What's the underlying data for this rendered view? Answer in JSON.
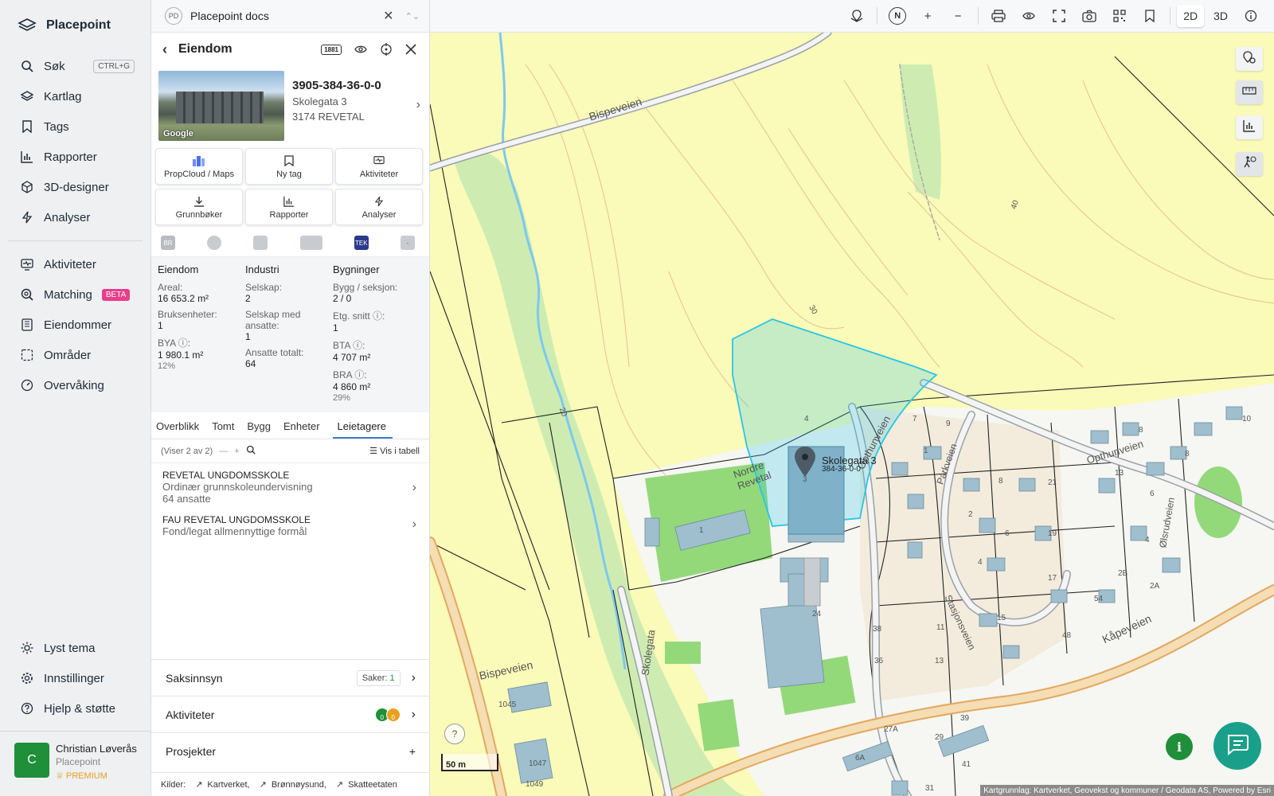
{
  "app": {
    "name": "Placepoint"
  },
  "nav": {
    "items": [
      {
        "label": "Søk",
        "icon": "search-icon",
        "shortcut": "CTRL+G"
      },
      {
        "label": "Kartlag",
        "icon": "layers-icon"
      },
      {
        "label": "Tags",
        "icon": "bookmark-icon"
      },
      {
        "label": "Rapporter",
        "icon": "bar-chart-icon"
      },
      {
        "label": "3D-designer",
        "icon": "cube-icon"
      },
      {
        "label": "Analyser",
        "icon": "lightning-icon"
      },
      {
        "label": "Aktiviteter",
        "icon": "monitor-pulse-icon"
      },
      {
        "label": "Matching",
        "icon": "search-magnify-icon",
        "badge": "BETA"
      },
      {
        "label": "Eiendommer",
        "icon": "building-icon"
      },
      {
        "label": "Områder",
        "icon": "dashed-square-icon"
      },
      {
        "label": "Overvåking",
        "icon": "gauge-icon"
      }
    ],
    "bottom": [
      {
        "label": "Lyst tema",
        "icon": "sun-icon"
      },
      {
        "label": "Innstillinger",
        "icon": "gear-icon"
      },
      {
        "label": "Hjelp & støtte",
        "icon": "help-circle-icon"
      }
    ],
    "user": {
      "initial": "C",
      "name": "Christian Løverås",
      "org": "Placepoint",
      "plan": "PREMIUM"
    }
  },
  "docbar": {
    "badge": "PD",
    "title": "Placepoint docs"
  },
  "panel": {
    "title": "Eiendom",
    "badge_1881": "1881",
    "property": {
      "id": "3905-384-36-0-0",
      "street": "Skolegata 3",
      "city": "3174 REVETAL",
      "photo_credit": "Google"
    },
    "actions": [
      {
        "label": "PropCloud / Maps",
        "icon": "cloud-icon"
      },
      {
        "label": "Ny tag",
        "icon": "bookmark-icon"
      },
      {
        "label": "Aktiviteter",
        "icon": "monitor-pulse-icon"
      },
      {
        "label": "Grunnbøker",
        "icon": "download-icon"
      },
      {
        "label": "Rapporter",
        "icon": "bar-chart-icon"
      },
      {
        "label": "Analyser",
        "icon": "lightning-icon"
      }
    ],
    "source_icons": {
      "br": "BR",
      "tek": "TEK",
      "dash": "-"
    },
    "stats": {
      "eiendom": {
        "title": "Eiendom",
        "areal_label": "Areal:",
        "areal_value": "16 653.2",
        "areal_unit": "m²",
        "bruks_label": "Bruksenheter:",
        "bruks_value": "1",
        "bya_label": "BYA ⓘ:",
        "bya_value": "1 980.1",
        "bya_unit": "m²",
        "bya_pct": "12%"
      },
      "industri": {
        "title": "Industri",
        "selskap_label": "Selskap:",
        "selskap_value": "2",
        "ansatte_label": "Selskap med ansatte:",
        "ansatte_value": "1",
        "total_label": "Ansatte totalt:",
        "total_value": "64"
      },
      "bygninger": {
        "title": "Bygninger",
        "bygg_label": "Bygg / seksjon:",
        "bygg_value": "2 / 0",
        "etg_label": "Etg. snitt ⓘ:",
        "etg_value": "1",
        "bta_label": "BTA ⓘ:",
        "bta_value": "4 707",
        "bta_unit": "m²",
        "bra_label": "BRA ⓘ:",
        "bra_value": "4 860",
        "bra_unit": "m²",
        "bra_pct": "29%"
      }
    },
    "tabs": [
      "Overblikk",
      "Tomt",
      "Bygg",
      "Enheter",
      "Leietagere"
    ],
    "active_tab": "Leietagere",
    "list": {
      "count": "(Viser 2 av 2)",
      "table_label": "Vis i tabell"
    },
    "tenants": [
      {
        "name": "REVETAL UNGDOMSSKOLE",
        "desc": "Ordinær grunnskoleundervisning",
        "extra": "64 ansatte"
      },
      {
        "name": "FAU REVETAL UNGDOMSSKOLE",
        "desc": "Fond/legat allmennyttige formål",
        "extra": ""
      }
    ],
    "accordion": {
      "saksinnsyn": "Saksinnsyn",
      "saker_label": "Saker:",
      "saker_count": "1",
      "aktiviteter": "Aktiviteter",
      "dot1": "0",
      "dot2": "0",
      "prosjekter": "Prosjekter",
      "plus": "+"
    },
    "sources": {
      "label": "Kilder:",
      "items": [
        "Kartverket,",
        "Brønnøysund,",
        "Skatteetaten"
      ]
    }
  },
  "toolbar": {
    "north": "N",
    "zoom_in": "+",
    "zoom_out": "−",
    "mode_2d": "2D",
    "mode_3d": "3D"
  },
  "map": {
    "labels": {
      "bispeveien_top": "Bispeveien",
      "bispeveien_bottom": "Bispeveien",
      "skolegata": "Skolegata",
      "nordre_revetal": "Nordre Revetal",
      "opthunveien": "Opthunveien",
      "opthunveien_right": "Opthunveien",
      "kapeveien": "Kåpeveien",
      "parkveien": "Parkveien",
      "stasjonsveien": "Stasjonsveien",
      "olsrudveien": "Ølsrudveien",
      "contour_40": "40",
      "contour_30": "30",
      "contour_20": "20"
    },
    "pin_title": "Skolegata 3",
    "pin_sub": "384-36-0-0",
    "house_numbers": [
      "4",
      "3",
      "1",
      "24",
      "1045",
      "1047",
      "1049",
      "7",
      "9",
      "1",
      "4",
      "8",
      "2",
      "6",
      "21",
      "19",
      "17",
      "13",
      "10",
      "8",
      "8",
      "6",
      "4",
      "2B",
      "2A",
      "54",
      "48",
      "15",
      "11",
      "13",
      "38",
      "36",
      "27A",
      "29",
      "39",
      "41",
      "31",
      "6A"
    ],
    "scale": "50 m",
    "help": "?",
    "attribution": "Kartgrunnlag: Kartverket, Geovekst og kommuner / Geodata AS, Powered by Esri",
    "info": "i",
    "colors": {
      "forest": "#fafab9",
      "green": "#c9eab0",
      "park": "#93d97a",
      "building": "#9fbfcf",
      "selection": "#29c5e6",
      "water": "#7ec8ef"
    }
  }
}
